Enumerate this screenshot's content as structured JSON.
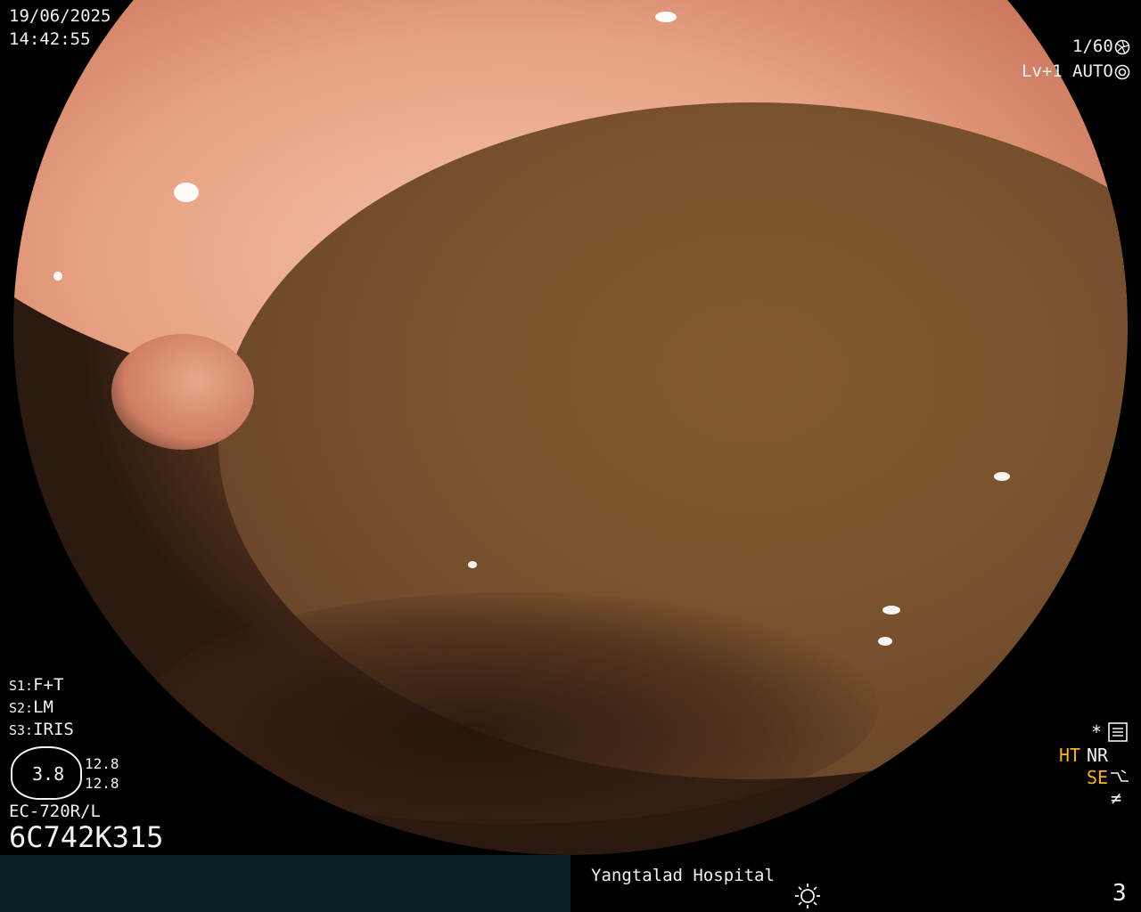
{
  "datetime": {
    "date": "19/06/2025",
    "time": "14:42:55"
  },
  "settings_top_right": {
    "shutter": "1/60",
    "level": "Lv+1",
    "iris_mode": "AUTO",
    "shutter_icon": "shutter-icon",
    "auto_icon": "auto-iris-icon"
  },
  "switches": {
    "s1": "F+T",
    "s2": "LM",
    "s3": "IRIS"
  },
  "switch_labels": {
    "s1": "S1:",
    "s2": "S2:",
    "s3": "S3:"
  },
  "gauge": {
    "value": "3.8",
    "upper": "12.8",
    "lower": "12.8"
  },
  "scope_model": "EC-720R/L",
  "serial": "6C742K315",
  "indicators": {
    "star": "*",
    "ht": "HT",
    "nr": "NR",
    "se": "SE",
    "neq": "≠"
  },
  "footer": {
    "hospital": "Yangtalad Hospital",
    "page": "3",
    "light_icon": "light-icon"
  },
  "colors": {
    "accent_orange": "#ffb21a",
    "footer_bg": "#0a2124"
  }
}
